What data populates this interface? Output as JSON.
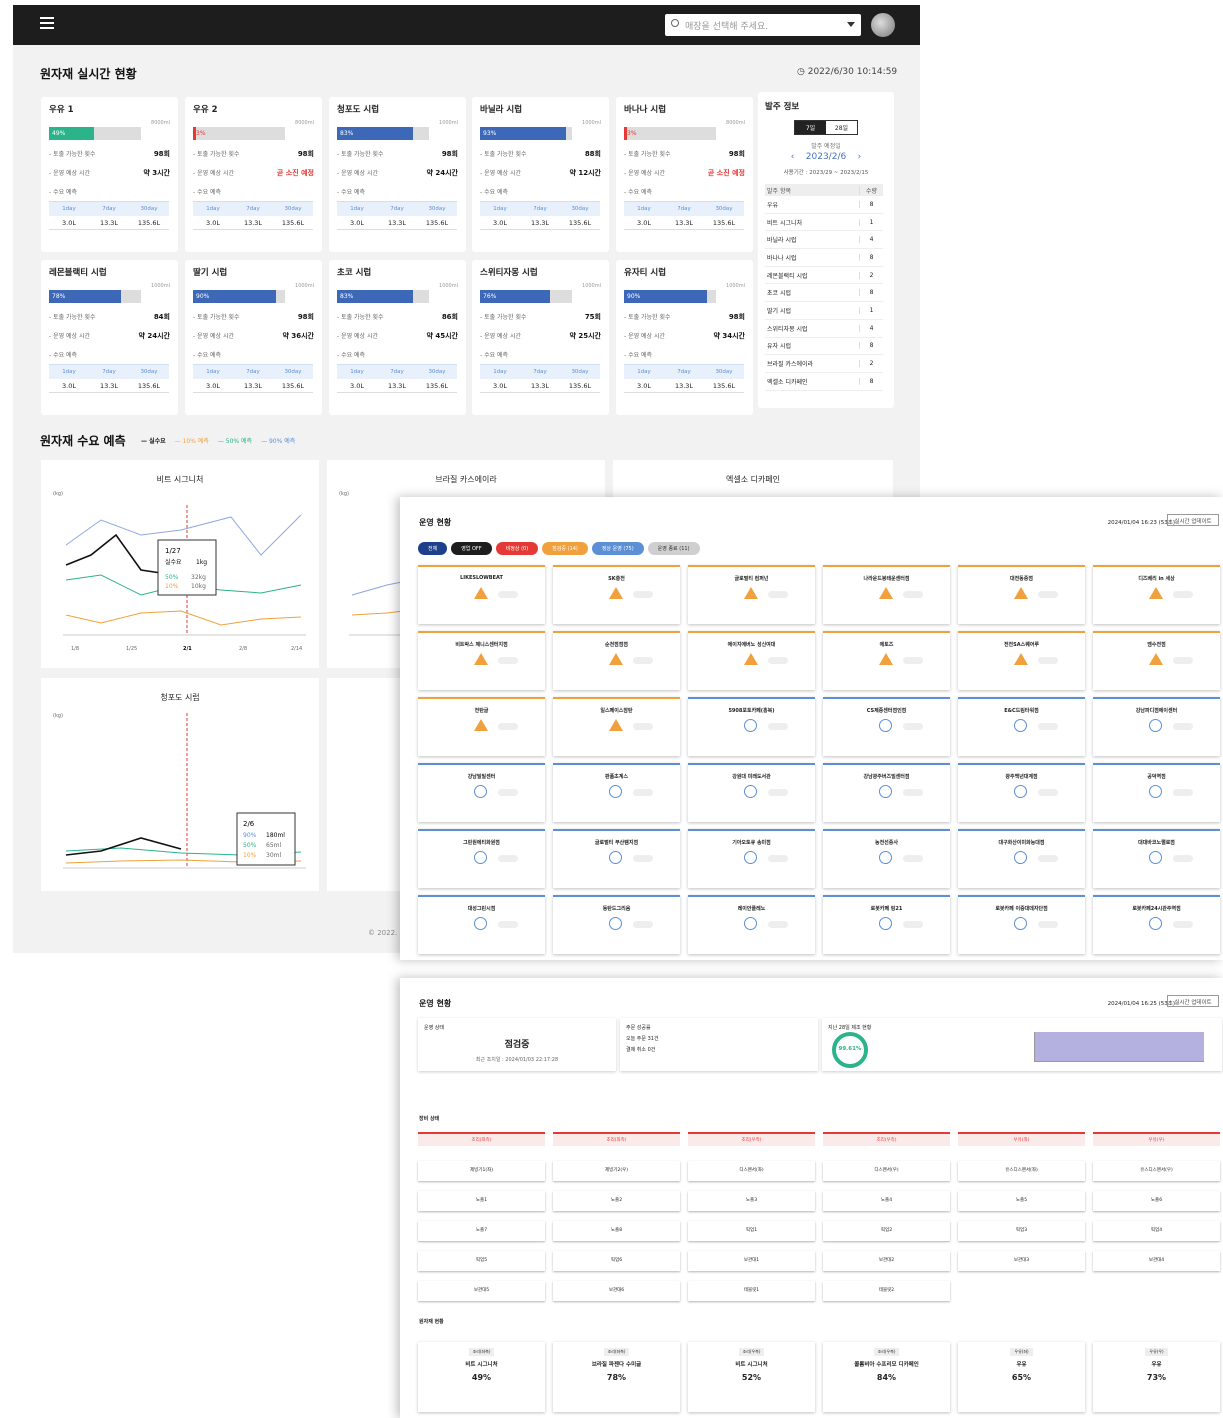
{
  "header": {
    "store_placeholder": "매장을 선택해 주세요.",
    "section_title": "원자재 실시간 현황",
    "timestamp": "2022/6/30 10:14:59"
  },
  "labels": {
    "pump_count": "- 토출 가능한 횟수",
    "op_time": "- 운영 예상 시간",
    "demand": "- 수요 예측",
    "periods": [
      "1day",
      "7day",
      "30day"
    ],
    "values": [
      "3.0L",
      "13.3L",
      "135.6L"
    ]
  },
  "cards": [
    {
      "name": "우유 1",
      "cap": "8000ml",
      "pct": "49%",
      "level": 0.49,
      "color": "#2bb38a",
      "count": "98회",
      "time": "약 3시간",
      "warn": false
    },
    {
      "name": "우유 2",
      "cap": "8000ml",
      "pct": "3%",
      "level": 0.03,
      "color": "#e53935",
      "count": "98회",
      "time": "곧 소진 예정",
      "warn": true
    },
    {
      "name": "청포도 시럽",
      "cap": "1000ml",
      "pct": "83%",
      "level": 0.83,
      "color": "#3d68b8",
      "count": "98회",
      "time": "약 24시간",
      "warn": false
    },
    {
      "name": "바닐라 시럽",
      "cap": "1000ml",
      "pct": "93%",
      "level": 0.93,
      "color": "#3d68b8",
      "count": "88회",
      "time": "약 12시간",
      "warn": false
    },
    {
      "name": "바나나 시럽",
      "cap": "8000ml",
      "pct": "3%",
      "level": 0.03,
      "color": "#e53935",
      "count": "98회",
      "time": "곧 소진 예정",
      "warn": true
    },
    {
      "name": "레몬블랙티 시럽",
      "cap": "1000ml",
      "pct": "78%",
      "level": 0.78,
      "color": "#3d68b8",
      "count": "84회",
      "time": "약 24시간",
      "warn": false
    },
    {
      "name": "딸기 시럽",
      "cap": "1000ml",
      "pct": "90%",
      "level": 0.9,
      "color": "#3d68b8",
      "count": "98회",
      "time": "약 36시간",
      "warn": false
    },
    {
      "name": "초코 시럽",
      "cap": "1000ml",
      "pct": "83%",
      "level": 0.83,
      "color": "#3d68b8",
      "count": "86회",
      "time": "약 45시간",
      "warn": false
    },
    {
      "name": "스위티자몽 시럽",
      "cap": "1000ml",
      "pct": "76%",
      "level": 0.76,
      "color": "#3d68b8",
      "count": "75회",
      "time": "약 25시간",
      "warn": false
    },
    {
      "name": "유자티 시럽",
      "cap": "1000ml",
      "pct": "90%",
      "level": 0.9,
      "color": "#3d68b8",
      "count": "98회",
      "time": "약 34시간",
      "warn": false
    }
  ],
  "order": {
    "title": "발주 정보",
    "tabs": [
      "7일",
      "28일"
    ],
    "date_label": "발주 예정일",
    "date": "2023/2/6",
    "period": "사용기간 : 2023/29 ~ 2023/2/15",
    "headers": [
      "발주 항목",
      "수량"
    ],
    "items": [
      [
        "우유",
        "8"
      ],
      [
        "비트 시그니처",
        "1"
      ],
      [
        "바닐라 시럽",
        "4"
      ],
      [
        "바나나 시럽",
        "8"
      ],
      [
        "레몬블랙티 시럽",
        "2"
      ],
      [
        "초코 시럽",
        "8"
      ],
      [
        "딸기 시럽",
        "1"
      ],
      [
        "스위티자몽 시럽",
        "4"
      ],
      [
        "유자 시럽",
        "8"
      ],
      [
        "브라질 카스에이라",
        "2"
      ],
      [
        "엑셀소 디카페인",
        "8"
      ]
    ]
  },
  "forecast": {
    "title": "원자재 수요 예측",
    "legend": [
      "— 실수요",
      "— 10% 예측",
      "— 50% 예측",
      "— 90% 예측"
    ],
    "charts": [
      {
        "title": "비트 시그니처",
        "yunit": "(kg)"
      },
      {
        "title": "브라질 카스에이라",
        "yunit": "(kg)"
      },
      {
        "title": "엑셀소 디카페인",
        "yunit": "(kg)"
      },
      {
        "title": "청포도 시럽",
        "yunit": "(kg)"
      }
    ],
    "tip1": {
      "date": "1/27",
      "l1": "실수요",
      "v1": "1kg",
      "l2": "50%",
      "v2": "32kg",
      "l3": "10%",
      "v3": "10kg"
    },
    "tip2": {
      "date": "2/6",
      "l1": "90%",
      "v1": "180ml",
      "l2": "50%",
      "v2": "65ml",
      "l3": "10%",
      "v3": "30ml"
    },
    "xticks1": [
      "1/8",
      "1/25",
      "2/1",
      "2/8",
      "2/14"
    ]
  },
  "footer": "© 2022.",
  "ops": {
    "title": "운영 현황",
    "time": "2024/01/04 16:23 (53초)",
    "refresh": "실시간 업데이트",
    "filters": [
      {
        "label": "전체",
        "color": "#1e3f8a"
      },
      {
        "label": "영업 OFF",
        "color": "#1d1d1d"
      },
      {
        "label": "비정상 (0)",
        "color": "#e53935"
      },
      {
        "label": "점검중 (14)",
        "color": "#f0a03c"
      },
      {
        "label": "정상 운영 (75)",
        "color": "#5b8fd6"
      },
      {
        "label": "운영 종료 (11)",
        "color": "#cfcfcf"
      }
    ],
    "stores": [
      "LIKESLOWBEAT",
      "SK충전",
      "글로벌티 컴퍼넌",
      "나라운드봉태운센터점",
      "대전동중점",
      "디즈베리 in 세상",
      "비트박스 제니스센터지점",
      "순천점점점",
      "에이지에버노 성신여대",
      "에토즈",
      "전전SA스퀘어루",
      "엠수전점",
      "전탄글",
      "일스페이스잠탄",
      "5908포토카페(홍복)",
      "CS제증센터점인점",
      "E&C드림타워점",
      "강남파디점에이센터",
      "강남밀밀센터",
      "판품초계스",
      "강원대 미래도서관",
      "강남광주버즈빌센터점",
      "광주백년대계점",
      "공덕역점",
      "그린원에티화원점",
      "글로벌티 부산템지점",
      "기아오토큐 송미점",
      "농전선중사",
      "대구화산이미화능대점",
      "대대바코노랠로점",
      "대성그린시점",
      "동탄드그리움",
      "레이안플레노",
      "로봇카페 링21",
      "로봇카페 이중대데자단점",
      "로봇카페24시관주역점"
    ],
    "statuses": [
      "warn",
      "warn",
      "warn",
      "warn",
      "warn",
      "warn",
      "warn",
      "warn",
      "warn",
      "warn",
      "warn",
      "warn",
      "warn",
      "warn",
      "ok",
      "ok",
      "ok",
      "ok",
      "ok",
      "ok",
      "ok",
      "ok",
      "ok",
      "ok",
      "ok",
      "ok",
      "ok",
      "ok",
      "ok",
      "ok",
      "ok",
      "ok",
      "ok",
      "ok",
      "ok",
      "ok"
    ]
  },
  "ops2": {
    "title": "운영 현황",
    "time": "2024/01/04 16:25 (53초)",
    "refresh": "실시간 업데이트",
    "state_label": "운영 상태",
    "state": "점검중",
    "state_sub": "최근 조치일 : 2024/01/03 22:17:28",
    "orders_label": "주문 성공률",
    "orders_l1": "오늘 주문 31건",
    "orders_l2": "결제 취소 0건",
    "chart_label": "지난 28일 제조 현황",
    "donut": "99.61%",
    "device_label": "장비 상태",
    "hdrs": [
      "조리(좌측)",
      "조리(좌측)",
      "조리(우측)",
      "조리(우측)",
      "우유(좌)",
      "우유(우)"
    ],
    "buttons": [
      "제빙기1(좌)",
      "제빙기2(우)",
      "디스펜서(좌)",
      "디스펜서(우)",
      "유스디스펜서(좌)",
      "유스디스펜서(우)",
      "노즐1",
      "노즐2",
      "노즐3",
      "노즐4",
      "노즐5",
      "노즐6",
      "노즐7",
      "노즐8",
      "픽업1",
      "픽업2",
      "픽업3",
      "픽업4",
      "픽업5",
      "픽업6",
      "보관대1",
      "보관대2",
      "보관대3",
      "보관대4",
      "보관대5",
      "보관대6",
      "테블릿1",
      "테블릿2"
    ],
    "mat_label": "원자재 현황",
    "mats": [
      {
        "tag": "조리(좌측)",
        "name": "비트 시그니처",
        "pct": "49%"
      },
      {
        "tag": "조리(좌측)",
        "name": "브라질 파젠다 수미글",
        "pct": "78%"
      },
      {
        "tag": "조리(우측)",
        "name": "비트 시그니처",
        "pct": "52%"
      },
      {
        "tag": "조리(우측)",
        "name": "콜롬비아 수프리모 디카페인",
        "pct": "84%"
      },
      {
        "tag": "우유(좌)",
        "name": "우유",
        "pct": "65%"
      },
      {
        "tag": "우유(우)",
        "name": "우유",
        "pct": "73%"
      }
    ]
  }
}
